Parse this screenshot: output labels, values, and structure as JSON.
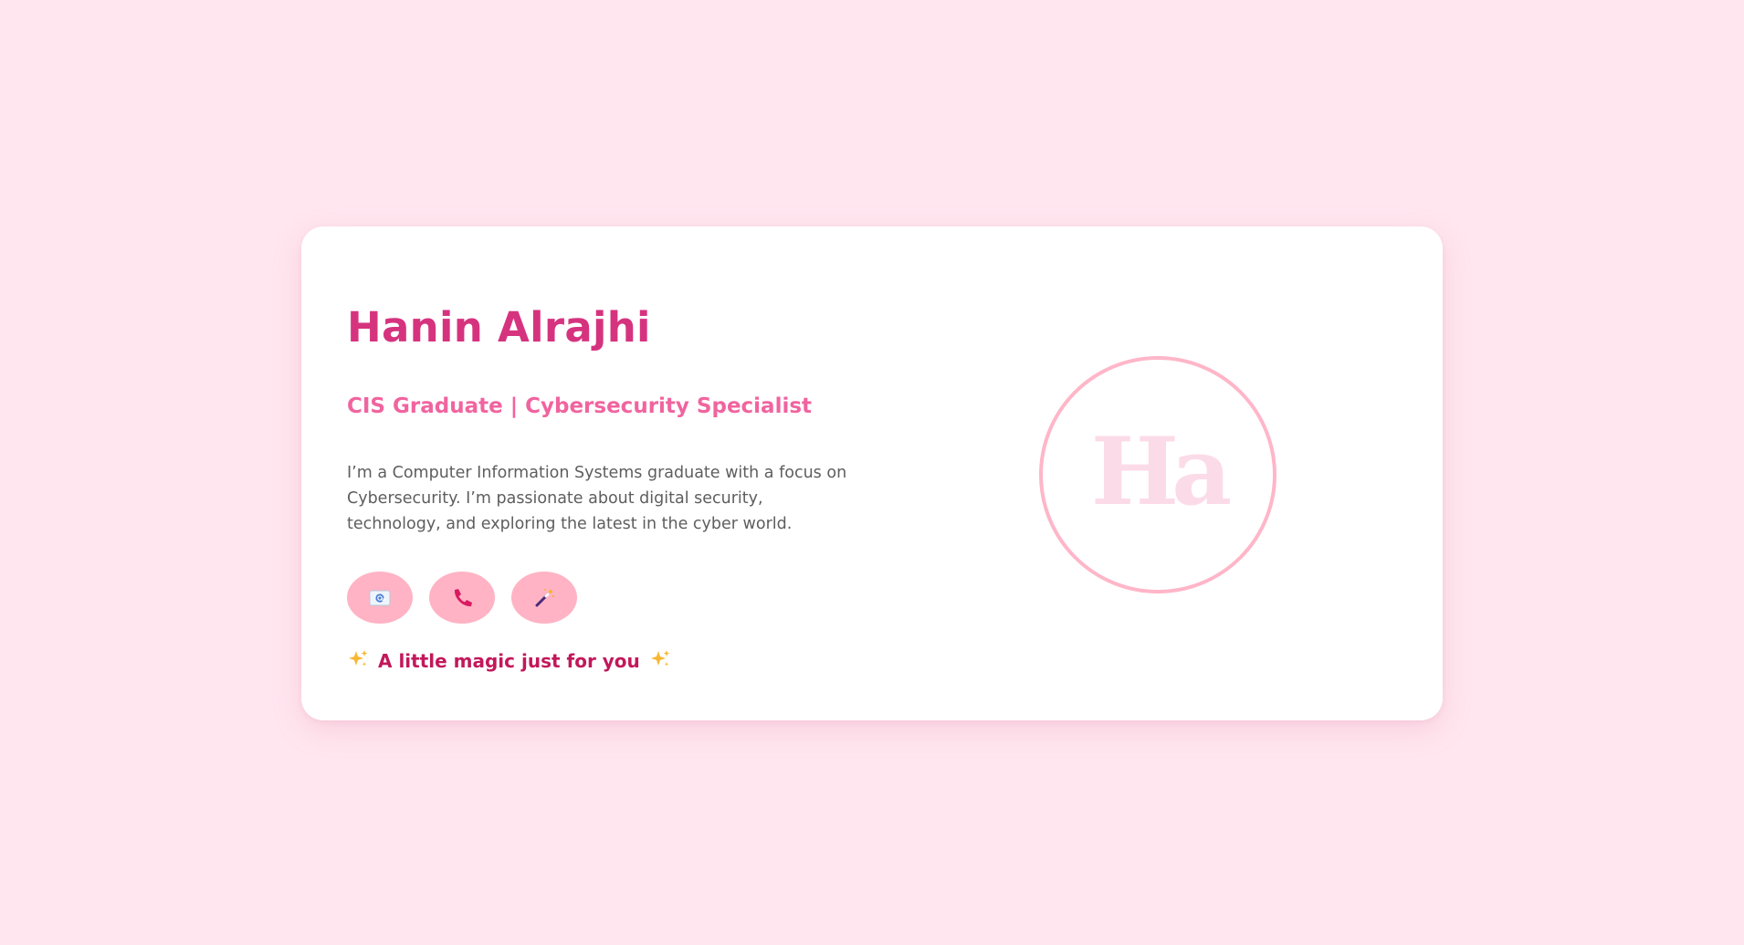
{
  "profile": {
    "name": "Hanin Alrajhi",
    "subtitle": "CIS Graduate | Cybersecurity Specialist",
    "bio": "I’m a Computer Information Systems graduate with a focus on Cybersecurity. I’m passionate about digital security, technology, and exploring the latest in the cyber world.",
    "monogram": "Ha"
  },
  "actions": [
    {
      "icon": "email-icon"
    },
    {
      "icon": "phone-icon"
    },
    {
      "icon": "magic-wand-icon"
    }
  ],
  "footer": {
    "magic_text": "A little magic just for you",
    "sparkle_left": "sparkles-icon",
    "sparkle_right": "sparkles-icon"
  },
  "colors": {
    "background": "#ffe6ef",
    "card": "#ffffff",
    "name": "#d6337f",
    "subtitle": "#f0649f",
    "button": "#ffb3c4",
    "circle_border": "#ffb6c8",
    "magic_text": "#c2185b"
  }
}
